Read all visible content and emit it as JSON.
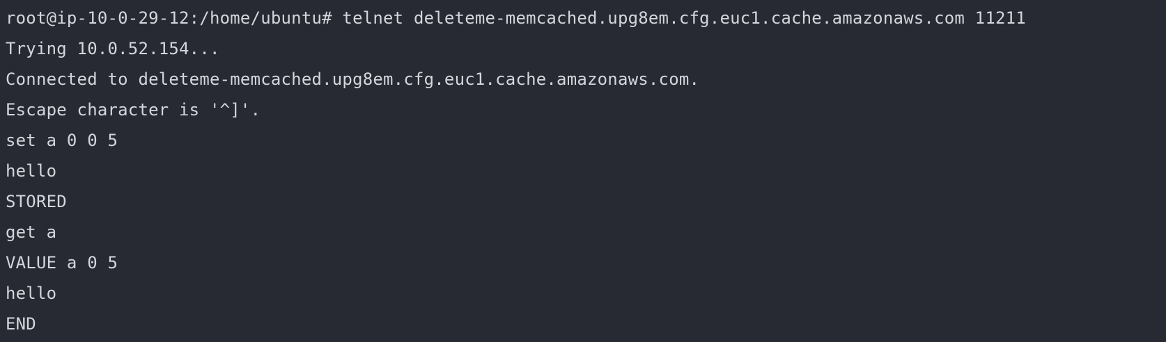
{
  "terminal": {
    "lines": [
      "root@ip-10-0-29-12:/home/ubuntu# telnet deleteme-memcached.upg8em.cfg.euc1.cache.amazonaws.com 11211",
      "Trying 10.0.52.154...",
      "Connected to deleteme-memcached.upg8em.cfg.euc1.cache.amazonaws.com.",
      "Escape character is '^]'.",
      "set a 0 0 5",
      "hello",
      "STORED",
      "get a",
      "VALUE a 0 5",
      "hello",
      "END"
    ]
  },
  "colors": {
    "background": "#282a33",
    "foreground": "#d4d6dc"
  }
}
